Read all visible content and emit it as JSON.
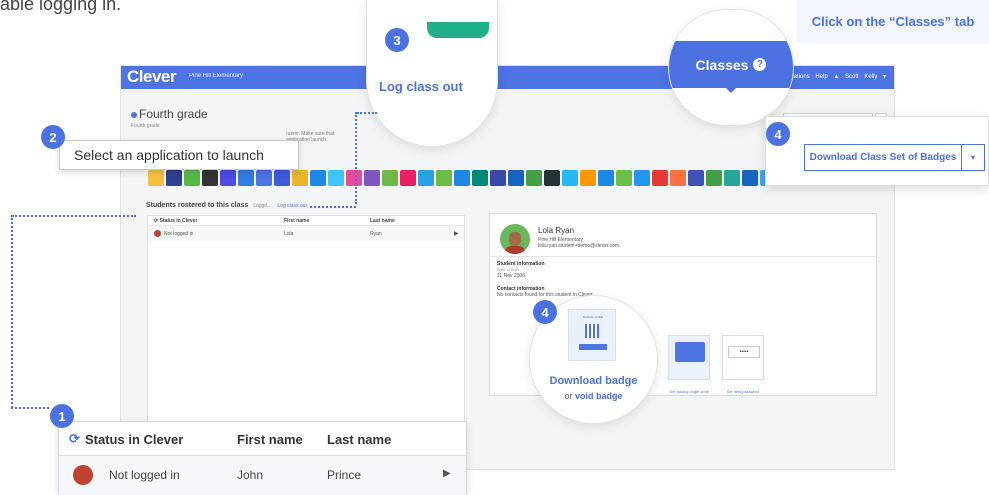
{
  "top_caption": "able logging in.",
  "hint": "Click on the “Classes” tab",
  "app": {
    "logo": "Clever",
    "school": "Pine Hill Elementary",
    "nav": "Applications   Help   ▲ Scott Kelly ▾",
    "class_title": "Fourth grade",
    "class_sub": "Fourth grade",
    "blurred_note": "ruiner. Make sure that application launch",
    "download_small": "Download Class Set of Badges",
    "students_title": "Students rostered to this class",
    "students_sep": "Loggd...",
    "log_class_out_small": "Log class out",
    "table_headers": [
      "Status in Clever",
      "First name",
      "Last name"
    ],
    "table_row": {
      "status": "Not logged in",
      "first": "Lola",
      "last": "Ryan"
    },
    "student": {
      "name": "Lola Ryan",
      "school": "Pine Hill Elementary",
      "email": "lola.ryan.student+demo@clever.com",
      "info_title": "Student information",
      "dob_label": "Date of Birth",
      "dob": "11 Nov 2006",
      "contact_title": "Contact information",
      "contact_text": "No contacts found for this student in Clever"
    },
    "backup_label": "Get backup login code",
    "password_label": "Set new password"
  },
  "callouts": {
    "n1": "1",
    "n2": "2",
    "n3": "3",
    "n4a": "4",
    "n4b": "4",
    "select_app": "Select an application to launch",
    "log_class_out": "Log class out",
    "classes_tab": "Classes",
    "help_glyph": "?",
    "download_class_set": "Download Class Set of Badges",
    "caret": "▾",
    "download_badge": "Download badge",
    "void_prefix": "or",
    "void_badge": "void badge",
    "badge_header": "BADGE CODE",
    "big_table_headers": [
      "Status in Clever",
      "First name",
      "Last name"
    ],
    "big_table_row": {
      "status": "Not logged in",
      "first": "John",
      "last": "Prince"
    }
  },
  "colors": {
    "accent": "#4b72e0",
    "nav": "#4c74e3"
  },
  "icons": [
    "refresh-icon",
    "play-icon",
    "help-icon",
    "caret-down-icon",
    "avatar-icon"
  ],
  "app_tile_colors": [
    "#f3c03c",
    "#2e3f8f",
    "#59b947",
    "#333",
    "#4e4ae3",
    "#2f7de1",
    "#4c74e3",
    "#3e5bd9",
    "#e7b72a",
    "#1e88e5",
    "#40c4ff",
    "#e64a9c",
    "#7e57c2",
    "#6dbb46",
    "#e91e63",
    "#2aa1e0",
    "#6dbb46",
    "#1e88e5",
    "#00897b",
    "#3949ab",
    "#1565c0",
    "#43a047",
    "#263238",
    "#29b6f6",
    "#ff9800",
    "#1e88e5",
    "#6cc04a",
    "#2196f3",
    "#e53935",
    "#ff7043",
    "#3f51b5",
    "#43a047",
    "#26a69a",
    "#1565c0",
    "#42a5f5",
    "#e53935",
    "#ab47bc",
    "#1e88e5",
    "#4caf50",
    "#ff9800",
    "#7cb342",
    "#f9a825",
    "#2e7d32",
    "#212121",
    "#e0e0e0"
  ]
}
